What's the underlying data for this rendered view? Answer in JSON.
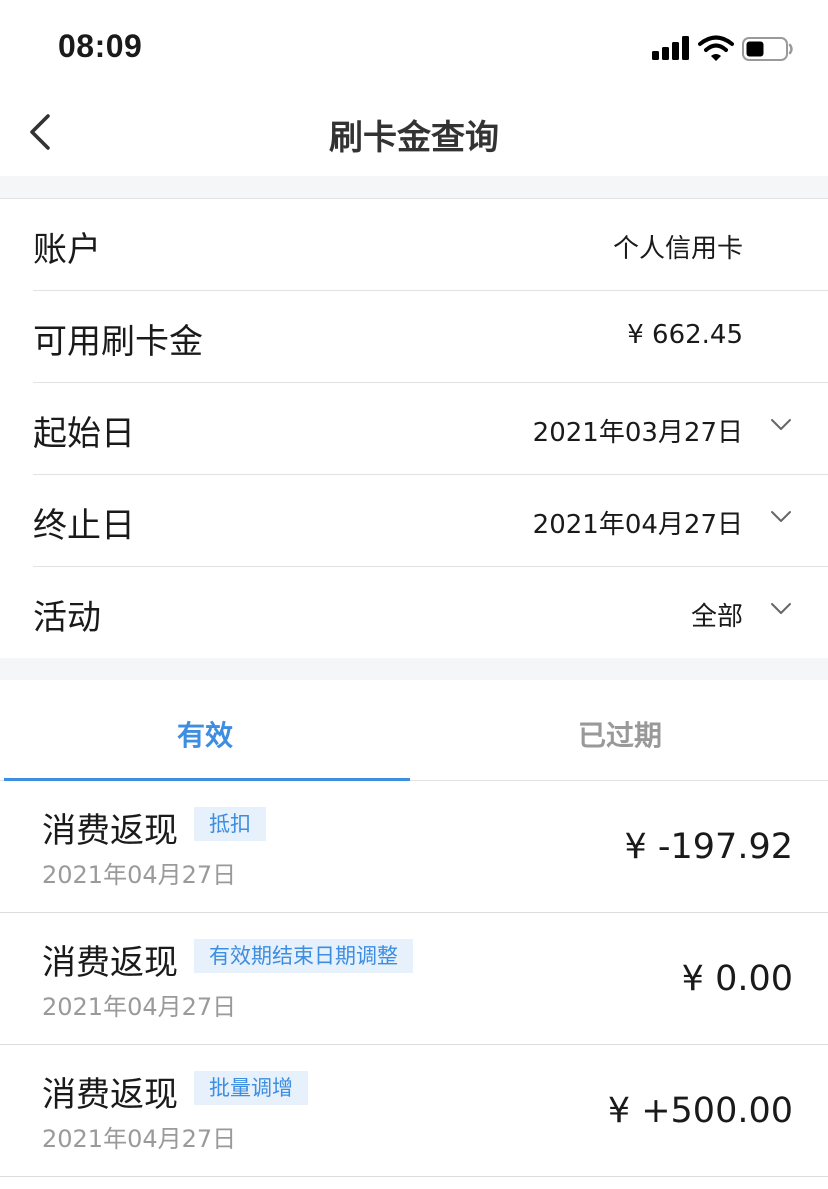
{
  "status_bar": {
    "time": "08:09"
  },
  "nav": {
    "title": "刷卡金查询"
  },
  "form": {
    "account": {
      "label": "账户",
      "value": "个人信用卡"
    },
    "available": {
      "label": "可用刷卡金",
      "value": "¥ 662.45"
    },
    "start_date": {
      "label": "起始日",
      "value": "2021年03月27日"
    },
    "end_date": {
      "label": "终止日",
      "value": "2021年04月27日"
    },
    "activity": {
      "label": "活动",
      "value": "全部"
    }
  },
  "tabs": [
    {
      "label": "有效",
      "active": true
    },
    {
      "label": "已过期",
      "active": false
    }
  ],
  "records": [
    {
      "title": "消费返现",
      "tag": "抵扣",
      "date": "2021年04月27日",
      "amount": "¥ -197.92"
    },
    {
      "title": "消费返现",
      "tag": "有效期结束日期调整",
      "date": "2021年04月27日",
      "amount": "¥ 0.00"
    },
    {
      "title": "消费返现",
      "tag": "批量调增",
      "date": "2021年04月27日",
      "amount": "¥ +500.00"
    }
  ],
  "colors": {
    "accent": "#3d8de0",
    "tag_bg": "#e6f1fc",
    "muted_text": "#9a9a9a",
    "divider": "#e2e2e2"
  },
  "icons": [
    "signal-icon",
    "wifi-icon",
    "battery-icon",
    "back-arrow-icon",
    "chevron-down-icon"
  ]
}
